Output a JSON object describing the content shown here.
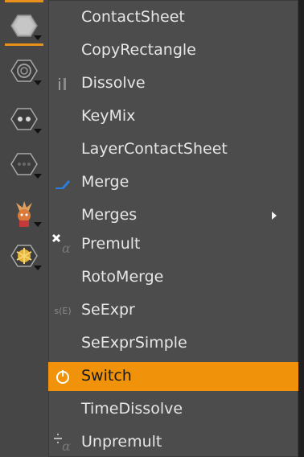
{
  "toolbar": {
    "tools": [
      {
        "icon": "image-node-icon",
        "active": true
      },
      {
        "icon": "draw-node-icon"
      },
      {
        "icon": "time-node-icon"
      },
      {
        "icon": "channel-node-icon"
      },
      {
        "icon": "color-node-icon"
      },
      {
        "icon": "filter-node-icon"
      }
    ],
    "accent_color": "#e8901a"
  },
  "menu": {
    "highlight_color": "#f0930b",
    "items": [
      {
        "label": "ContactSheet",
        "icon": null
      },
      {
        "label": "CopyRectangle",
        "icon": null
      },
      {
        "label": "Dissolve",
        "icon": "dissolve-icon"
      },
      {
        "label": "KeyMix",
        "icon": null
      },
      {
        "label": "LayerContactSheet",
        "icon": null
      },
      {
        "label": "Merge",
        "icon": "merge-icon"
      },
      {
        "label": "Merges",
        "icon": null,
        "has_submenu": true
      },
      {
        "label": "Premult",
        "icon": "premult-icon"
      },
      {
        "label": "RotoMerge",
        "icon": null
      },
      {
        "label": "SeExpr",
        "icon": "seexpr-icon",
        "icon_text": "s(E)"
      },
      {
        "label": "SeExprSimple",
        "icon": null
      },
      {
        "label": "Switch",
        "icon": "switch-icon",
        "highlighted": true
      },
      {
        "label": "TimeDissolve",
        "icon": null
      },
      {
        "label": "Unpremult",
        "icon": "unpremult-icon"
      }
    ]
  }
}
